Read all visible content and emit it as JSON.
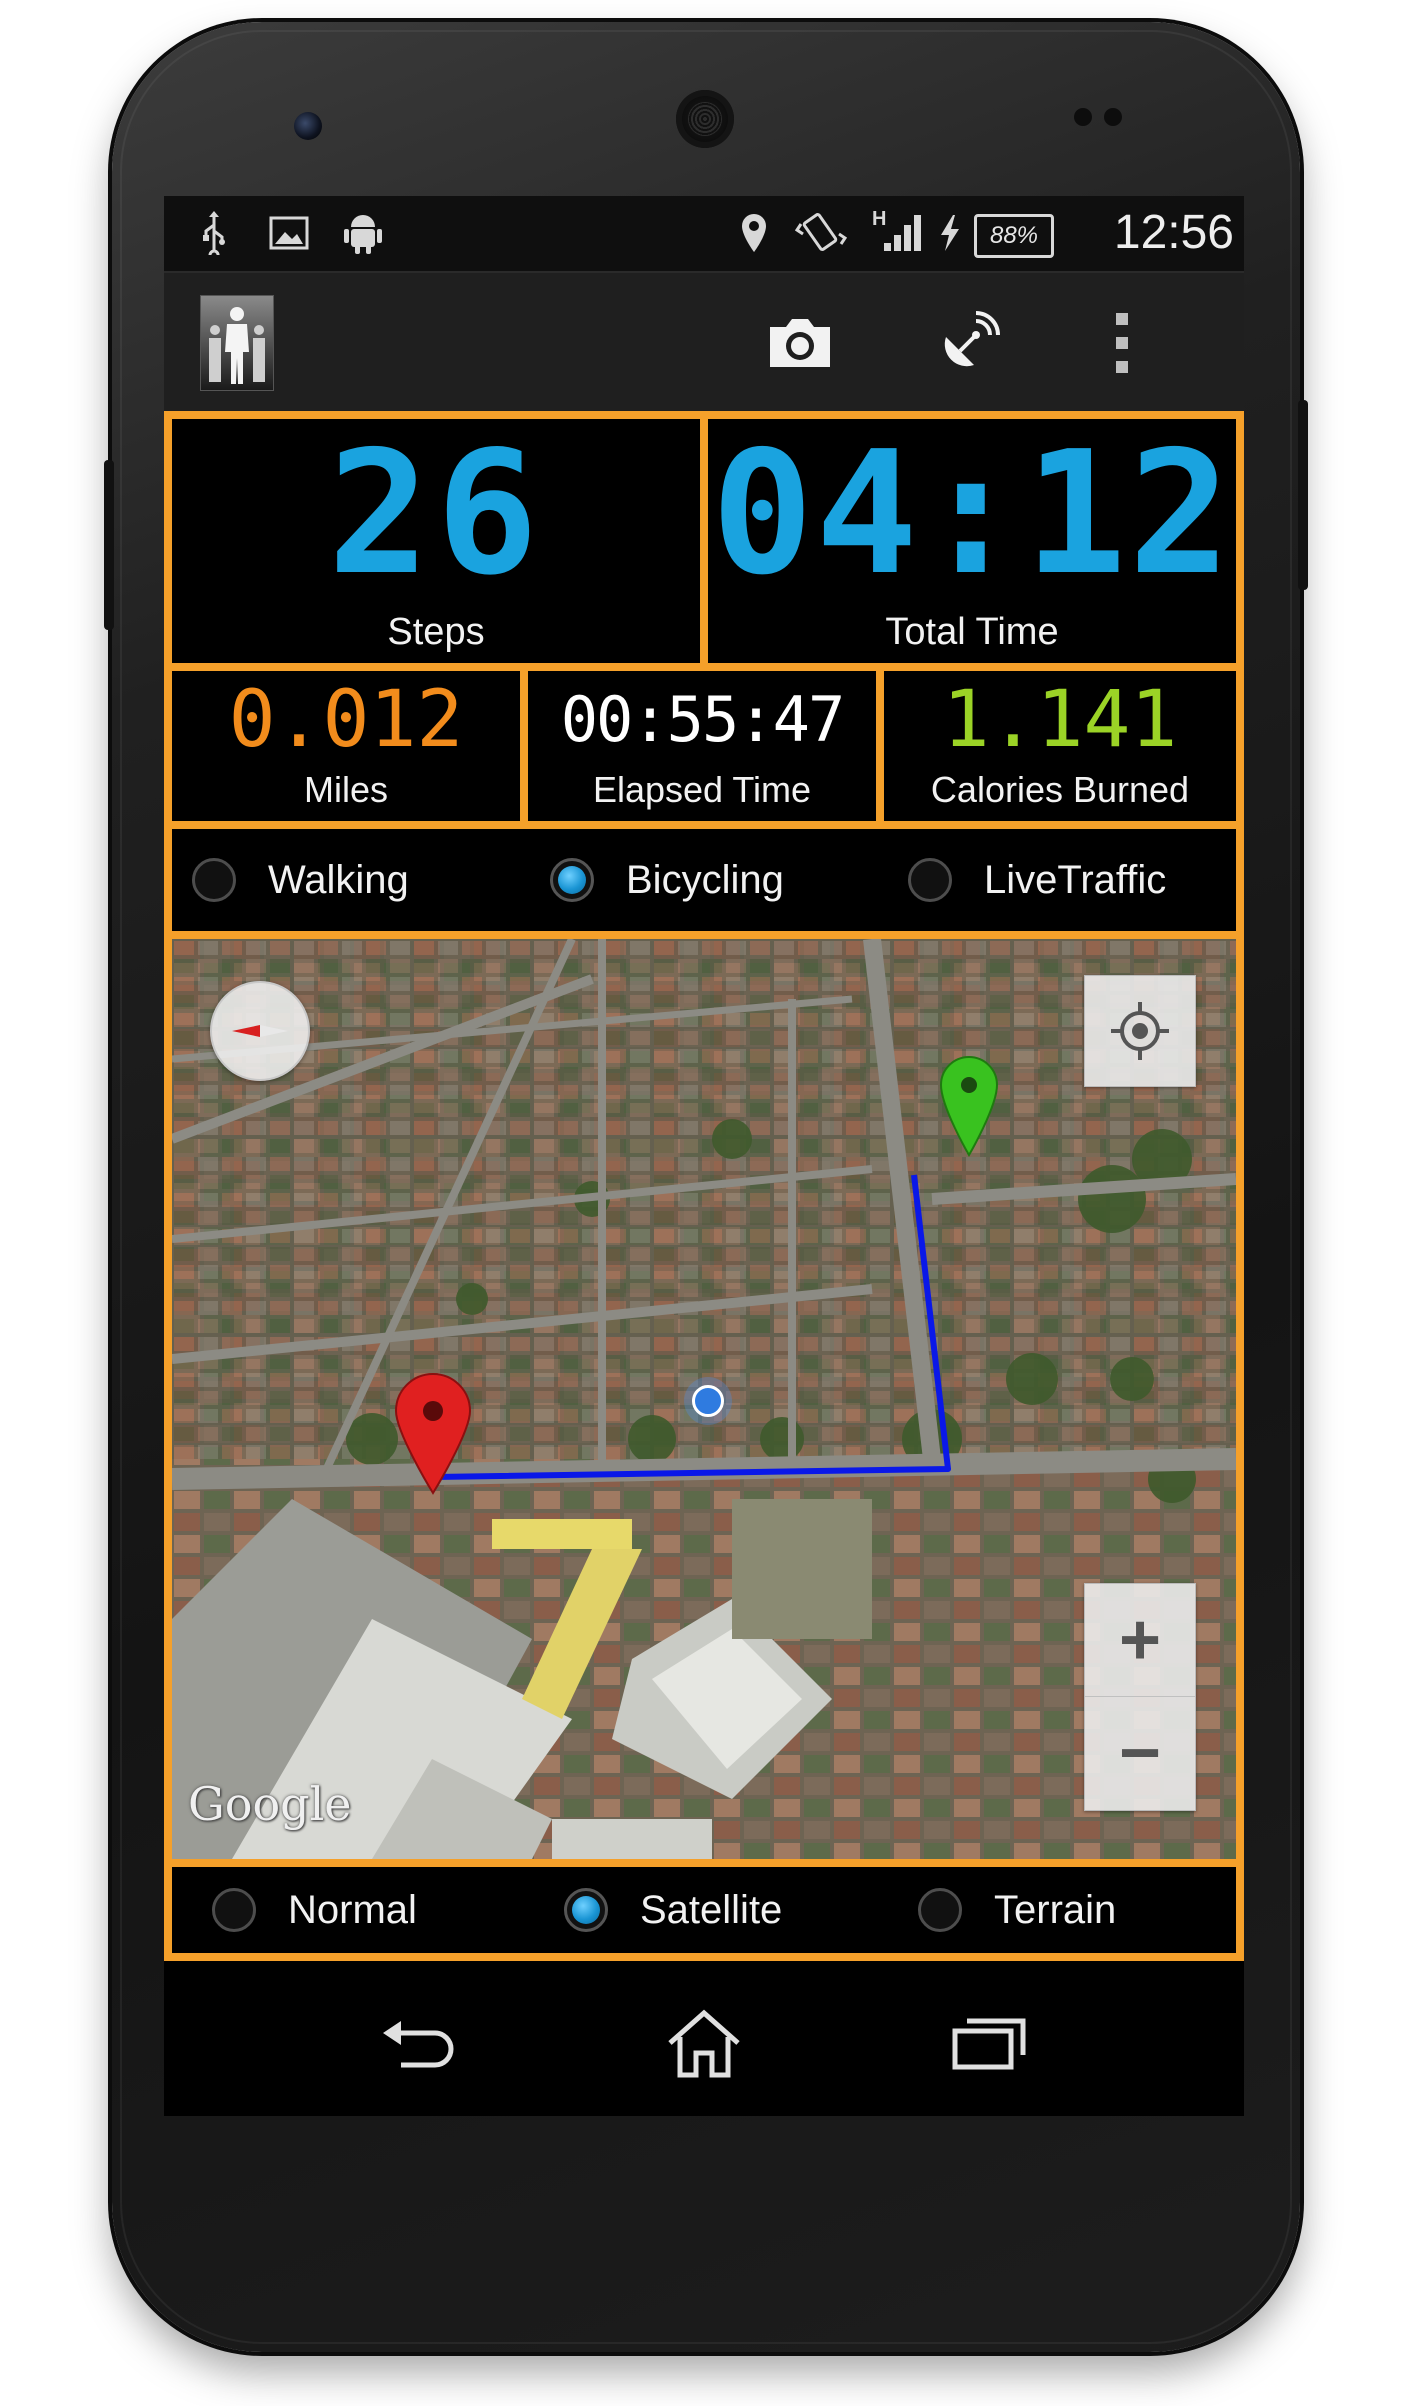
{
  "status_bar": {
    "battery": "88%",
    "network_label": "H",
    "time": "12:56",
    "icons": [
      "usb-icon",
      "image-icon",
      "android-icon",
      "location-icon",
      "vibrate-icon",
      "signal-icon",
      "charging-icon"
    ]
  },
  "action_bar": {
    "icons": [
      "app-logo",
      "camera-icon",
      "satellite-dish-icon",
      "overflow-menu-icon"
    ]
  },
  "stats": {
    "steps": {
      "value": "26",
      "label": "Steps"
    },
    "total_time": {
      "value": "04:12",
      "label": "Total Time"
    },
    "miles": {
      "value": "0.012",
      "label": "Miles"
    },
    "elapsed_time": {
      "value": "00:55:47",
      "label": "Elapsed Time"
    },
    "calories": {
      "value": "1.141",
      "label": "Calories Burned"
    }
  },
  "colors": {
    "accent_border": "#f5a02a",
    "digit_blue": "#1aa3df",
    "digit_orange": "#f28c1c",
    "digit_white": "#ffffff",
    "digit_green": "#9bd326",
    "route_line": "#0a18e8",
    "pin_start": "#e02020",
    "pin_end": "#39c21f"
  },
  "mode_options": {
    "selected": "Bicycling",
    "items": [
      "Walking",
      "Bicycling",
      "LiveTraffic"
    ]
  },
  "map": {
    "attribution": "Google",
    "controls": [
      "compass-icon",
      "my-location-icon",
      "zoom-in-icon",
      "zoom-out-icon"
    ],
    "zoom_in": "+",
    "zoom_out": "−"
  },
  "map_type_options": {
    "selected": "Satellite",
    "items": [
      "Normal",
      "Satellite",
      "Terrain"
    ]
  },
  "nav_bar": {
    "icons": [
      "back-icon",
      "home-icon",
      "recent-apps-icon"
    ]
  }
}
